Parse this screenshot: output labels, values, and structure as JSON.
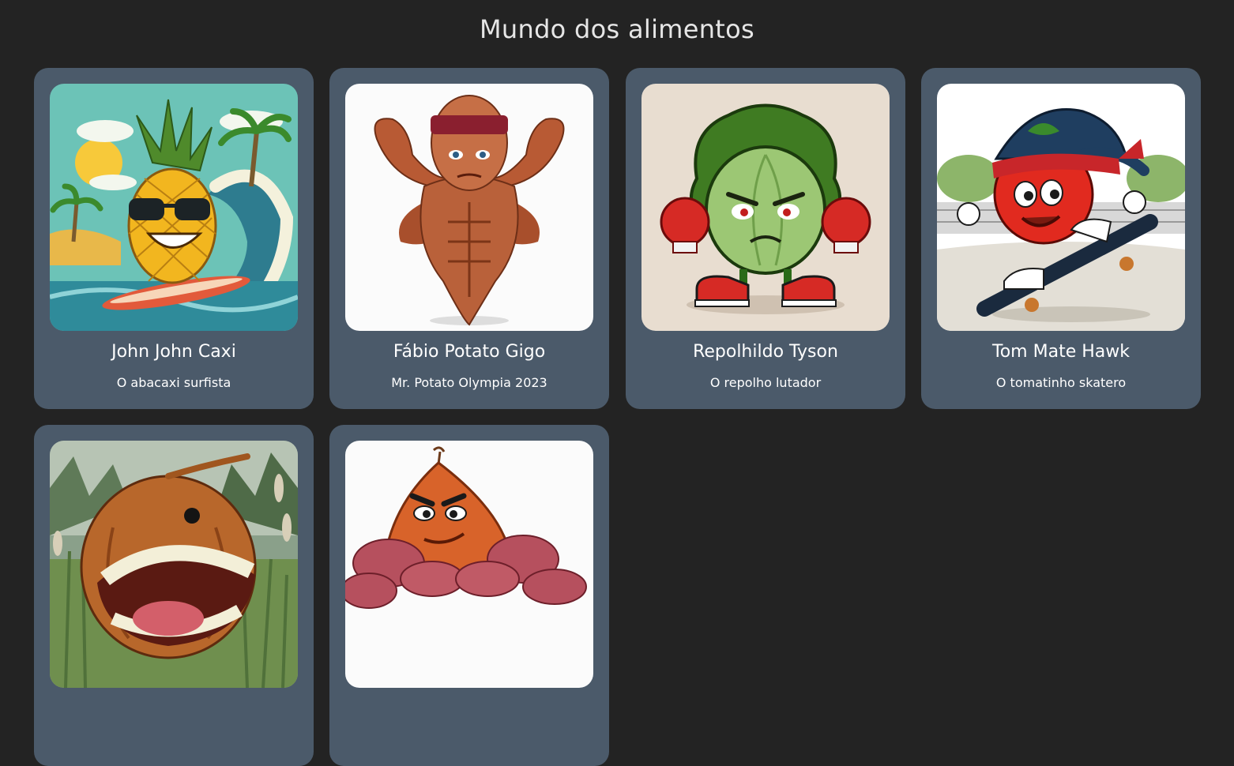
{
  "header": {
    "title": "Mundo dos alimentos"
  },
  "cards": [
    {
      "name": "John John Caxi",
      "description": "O abacaxi surfista",
      "image_icon": "pineapple-surfer-icon"
    },
    {
      "name": "Fábio Potato Gigo",
      "description": "Mr. Potato Olympia 2023",
      "image_icon": "muscle-potato-icon"
    },
    {
      "name": "Repolhildo Tyson",
      "description": "O repolho lutador",
      "image_icon": "boxing-cabbage-icon"
    },
    {
      "name": "Tom Mate Hawk",
      "description": "O tomatinho skatero",
      "image_icon": "skater-tomato-icon"
    },
    {
      "name": "",
      "description": "",
      "image_icon": "monster-onion-icon"
    },
    {
      "name": "",
      "description": "",
      "image_icon": "muscle-sweet-potato-icon"
    }
  ],
  "colors": {
    "background": "#232323",
    "card": "#4b5a6a",
    "title_text": "#e6e6e6",
    "card_text": "#ffffff"
  }
}
